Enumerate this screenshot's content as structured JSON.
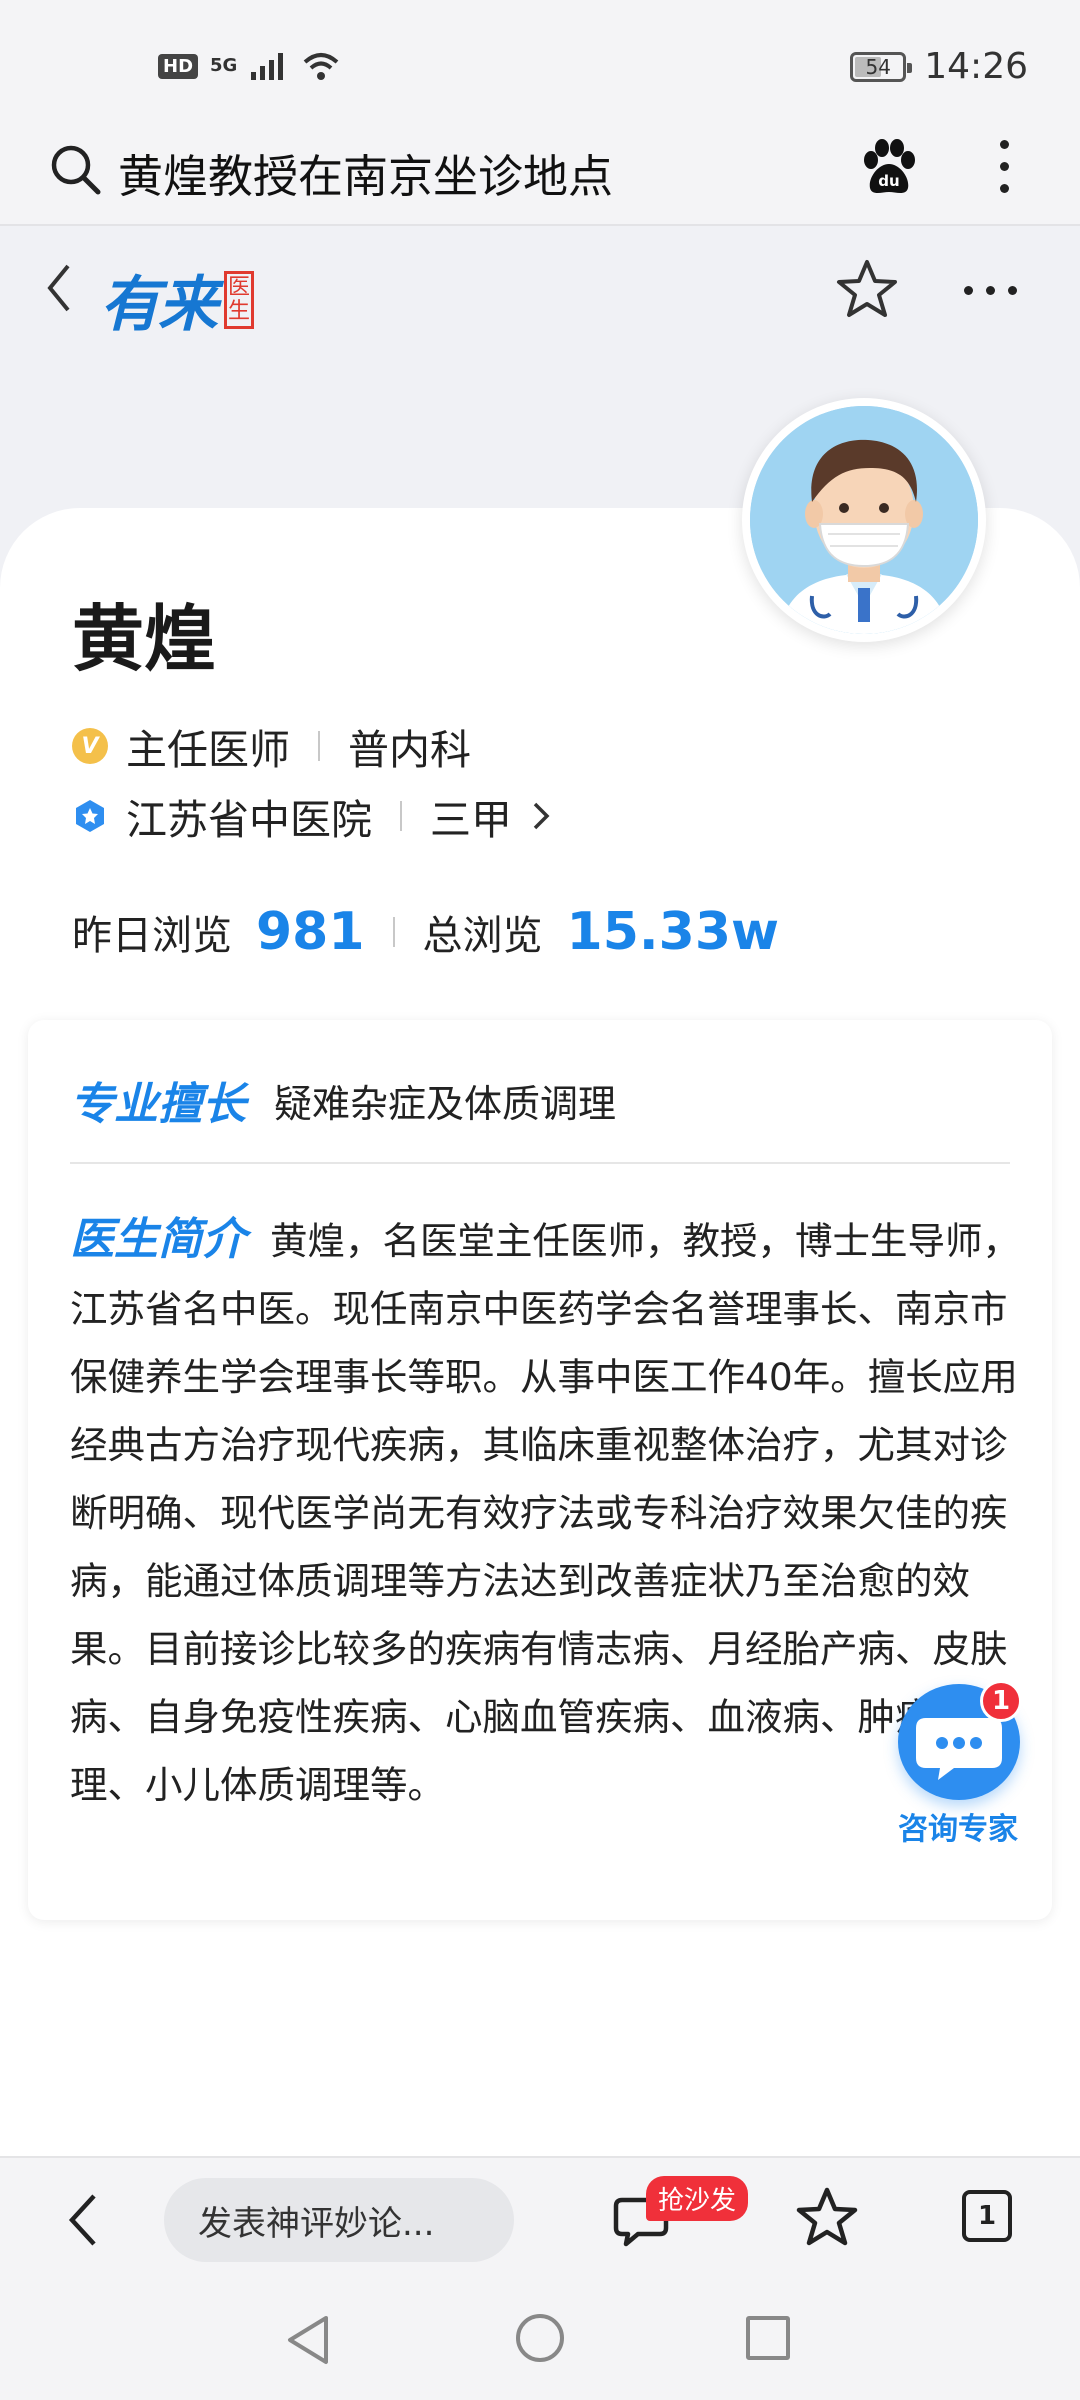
{
  "status": {
    "network": "5G",
    "hd": "HD",
    "battery": "54",
    "time": "14:26"
  },
  "search": {
    "query": "黄煌教授在南京坐诊地点"
  },
  "site": {
    "logo_text": "有来",
    "logo_tag_top": "医",
    "logo_tag_bottom": "生"
  },
  "doctor": {
    "name": "黄煌",
    "title": "主任医师",
    "department": "普内科",
    "hospital": "江苏省中医院",
    "level": "三甲",
    "badge_v": "V"
  },
  "stats": {
    "yesterday_label": "昨日浏览",
    "yesterday_value": "981",
    "total_label": "总浏览",
    "total_value": "15.33w"
  },
  "specialty": {
    "label": "专业擅长",
    "value": "疑难杂症及体质调理"
  },
  "intro": {
    "label": "医生简介",
    "text": "黄煌，名医堂主任医师，教授，博士生导师，江苏省名中医。现任南京中医药学会名誉理事长、南京市保健养生学会理事长等职。从事中医工作40年。擅长应用经典古方治疗现代疾病，其临床重视整体治疗，尤其对诊断明确、现代医学尚无有效疗法或专科治疗效果欠佳的疾病，能通过体质调理等方法达到改善症状乃至治愈的效果。目前接诊比较多的疾病有情志病、月经胎产病、皮肤病、自身免疫性疾病、心脑血管疾病、血液病、肿瘤调理、小儿体质调理等。"
  },
  "consult": {
    "label": "咨询专家",
    "badge": "1"
  },
  "bottom": {
    "comment_placeholder": "发表神评妙论...",
    "sofa": "抢沙发",
    "tab_count": "1"
  }
}
